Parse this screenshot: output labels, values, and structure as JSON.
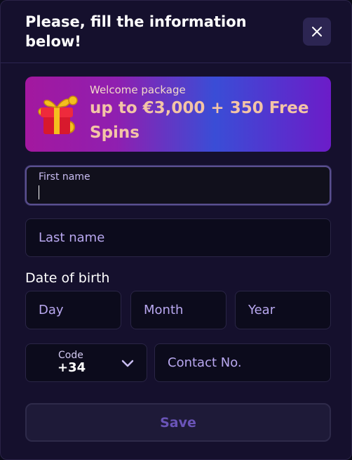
{
  "modal": {
    "title": "Please, fill the information below!",
    "close_icon": "close-icon"
  },
  "banner": {
    "label": "Welcome package",
    "offer": "up to €3,000 + 350 Free Spins",
    "icon": "gift-box-icon"
  },
  "form": {
    "first_name": {
      "label": "First name",
      "value": ""
    },
    "last_name": {
      "placeholder": "Last name"
    },
    "dob": {
      "label": "Date of birth",
      "day_placeholder": "Day",
      "month_placeholder": "Month",
      "year_placeholder": "Year"
    },
    "phone": {
      "code_label": "Code",
      "code_value": "+34",
      "contact_placeholder": "Contact No."
    },
    "save_label": "Save"
  },
  "colors": {
    "background": "#15102d",
    "field_bg": "#0c0b1c",
    "placeholder": "#b9a8f0",
    "save_text": "#6a54b8",
    "offer_text": "#f3c4a6"
  }
}
